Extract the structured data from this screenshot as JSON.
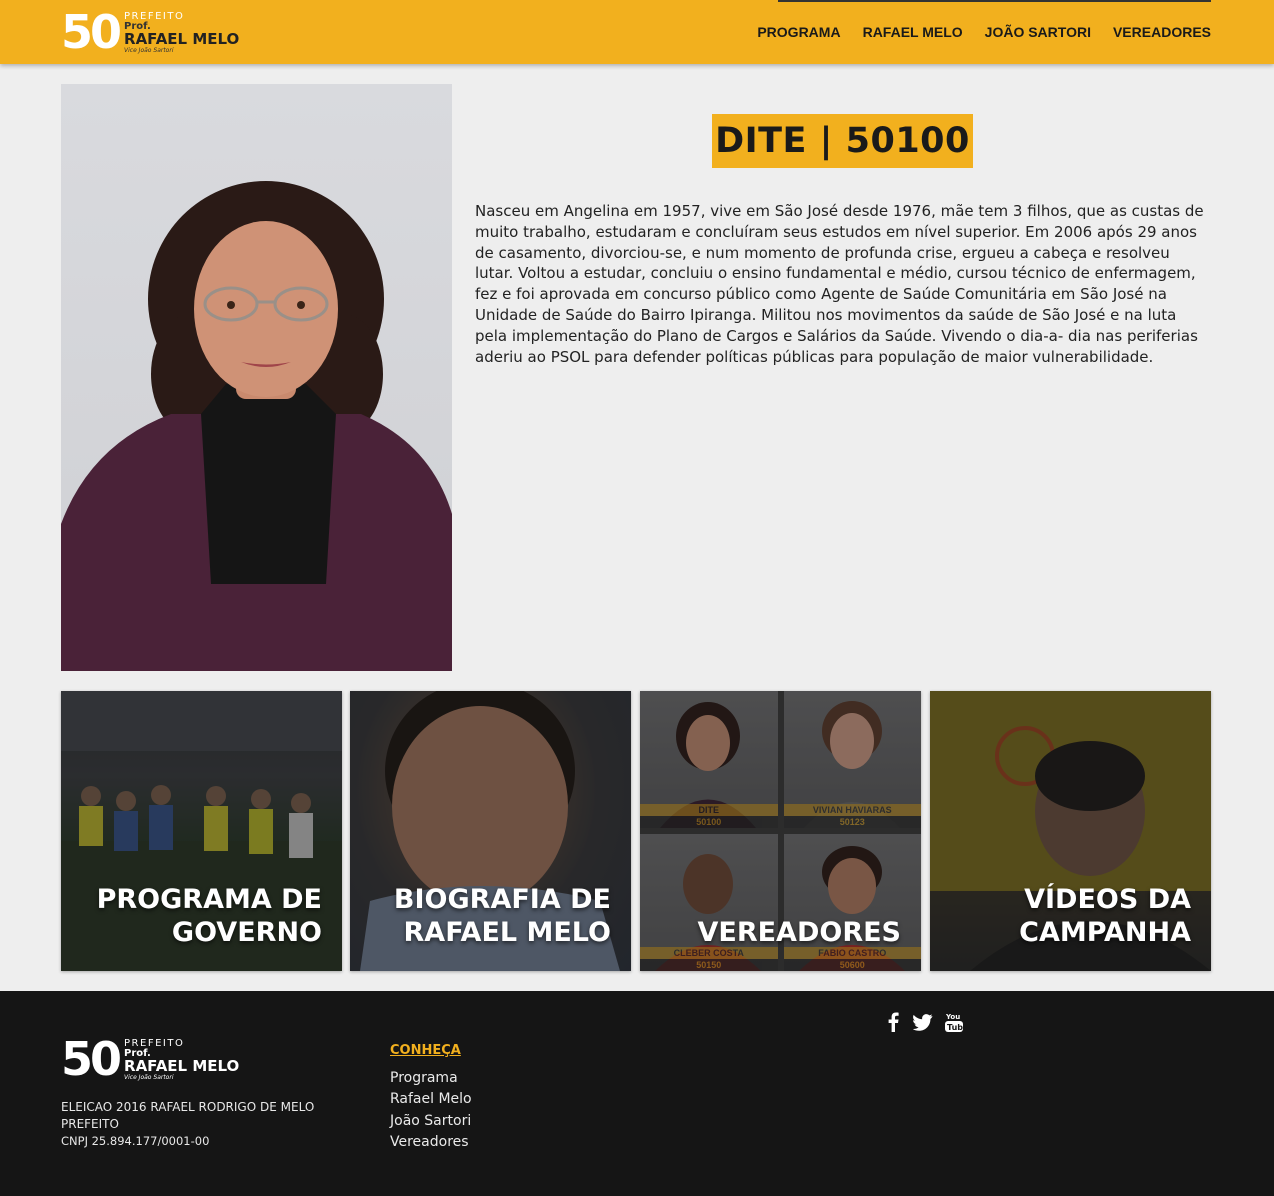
{
  "header": {
    "logo": {
      "number": "50",
      "line1": "PREFEITO",
      "line2": "Prof.",
      "line3": "RAFAEL MELO",
      "line4": "Vice João Sartori"
    },
    "nav": [
      "PROGRAMA",
      "RAFAEL MELO",
      "JOÃO SARTORI",
      "VEREADORES"
    ],
    "accent_color": "#f2b01e"
  },
  "candidate": {
    "title": "DITE | 50100",
    "bio": "Nasceu em Angelina em 1957, vive em São José desde 1976, mãe tem 3 filhos, que as custas de muito trabalho, estudaram e concluíram seus estudos em nível superior. Em 2006 após 29 anos de casamento, divorciou-se, e num momento de profunda crise, ergueu a cabeça e resolveu lutar. Voltou a estudar, concluiu o ensino fundamental e médio, cursou técnico de enfermagem, fez e foi aprovada em concurso público como Agente de Saúde Comunitária em São José na Unidade de Saúde do Bairro Ipiranga. Militou nos movimentos da saúde de São José e na luta pela implementação do Plano de Cargos e Salários da Saúde. Vivendo o dia-a- dia nas periferias aderiu ao PSOL para defender políticas públicas para população de maior vulnerabilidade."
  },
  "tiles": [
    {
      "line1": "PROGRAMA DE",
      "line2": "GOVERNO"
    },
    {
      "line1": "BIOGRAFIA DE",
      "line2": "RAFAEL MELO"
    },
    {
      "line1": "",
      "line2": "VEREADORES",
      "cells": [
        {
          "name": "DITE",
          "number": "50100"
        },
        {
          "name": "VIVIAN HAVIARAS",
          "number": "50123"
        },
        {
          "name": "CLEBER COSTA",
          "number": "50150"
        },
        {
          "name": "FABIO CASTRO",
          "number": "50600"
        }
      ]
    },
    {
      "line1": "VÍDEOS DA",
      "line2": "CAMPANHA"
    }
  ],
  "footer": {
    "logo": {
      "number": "50",
      "line1": "PREFEITO",
      "line2": "Prof.",
      "line3": "RAFAEL MELO",
      "line4": "Vice João Sartori"
    },
    "legal": [
      "ELEICAO 2016 RAFAEL RODRIGO DE MELO",
      "PREFEITO",
      "CNPJ 25.894.177/0001-00"
    ],
    "conheca_title": "CONHEÇA",
    "links": [
      "Programa",
      "Rafael Melo",
      "João Sartori",
      "Vereadores"
    ],
    "social": [
      "facebook-icon",
      "twitter-icon",
      "youtube-icon"
    ]
  }
}
